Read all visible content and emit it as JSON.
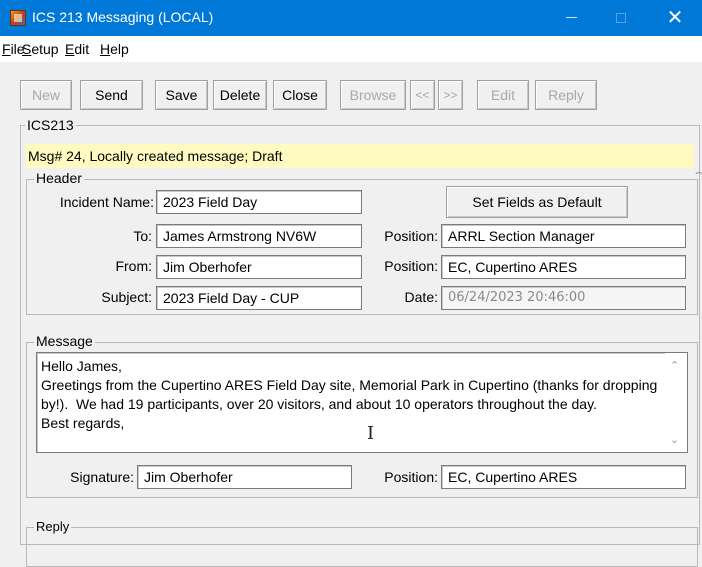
{
  "window": {
    "title": "ICS 213 Messaging (LOCAL)",
    "controls": {
      "minimize": "—",
      "maximize": "□",
      "close": "✕"
    }
  },
  "menu": [
    {
      "label": "File",
      "accel": "F"
    },
    {
      "label": "Setup",
      "accel": "S"
    },
    {
      "label": "Edit",
      "accel": "E"
    },
    {
      "label": "Help",
      "accel": "H"
    }
  ],
  "toolbar": {
    "new": "New",
    "send": "Send",
    "save": "Save",
    "delete": "Delete",
    "close": "Close",
    "browse": "Browse",
    "prev": "<<",
    "next": ">>",
    "edit": "Edit",
    "reply": "Reply"
  },
  "form": {
    "group_label": "ICS213",
    "status": "Msg# 24,  Locally created message; Draft",
    "header": {
      "group_label": "Header",
      "incident_label": "Incident Name:",
      "incident_value": "2023 Field Day",
      "set_default_label": "Set Fields as Default",
      "to_label": "To:",
      "to_value": "James Armstrong NV6W",
      "to_position_label": "Position:",
      "to_position_value": "ARRL Section Manager",
      "from_label": "From:",
      "from_value": "Jim Oberhofer",
      "from_position_label": "Position:",
      "from_position_value": "EC, Cupertino ARES",
      "subject_label": "Subject:",
      "subject_value": "2023 Field Day - CUP",
      "date_label": "Date:",
      "date_value": "06/24/2023  20:46:00"
    },
    "message": {
      "group_label": "Message",
      "body": "Hello James,\nGreetings from the Cupertino ARES Field Day site, Memorial Park in Cupertino (thanks for dropping by!).  We had 19 participants, over 20 visitors, and about 10 operators throughout the day.\nBest regards,",
      "signature_label": "Signature:",
      "signature_value": "Jim Oberhofer",
      "position_label": "Position:",
      "position_value": "EC, Cupertino ARES"
    },
    "reply": {
      "group_label": "Reply"
    }
  }
}
